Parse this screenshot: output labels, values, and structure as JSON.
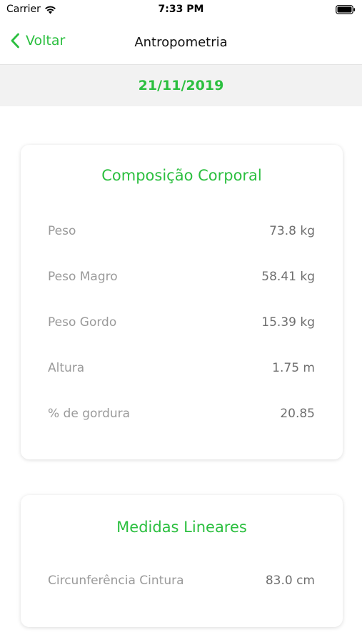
{
  "status_bar": {
    "carrier": "Carrier",
    "time": "7:33 PM"
  },
  "nav": {
    "back_label": "Voltar",
    "title": "Antropometria"
  },
  "date": "21/11/2019",
  "composicao": {
    "title": "Composição Corporal",
    "rows": [
      {
        "label": "Peso",
        "value": "73.8 kg"
      },
      {
        "label": "Peso Magro",
        "value": "58.41 kg"
      },
      {
        "label": "Peso Gordo",
        "value": "15.39 kg"
      },
      {
        "label": "Altura",
        "value": "1.75 m"
      },
      {
        "label": "% de gordura",
        "value": "20.85"
      }
    ]
  },
  "medidas": {
    "title": "Medidas Lineares",
    "rows": [
      {
        "label": "Circunferência Cintura",
        "value": "83.0 cm"
      }
    ]
  },
  "colors": {
    "accent": "#2bbf3f",
    "date_band": "#f2f2f2",
    "label_gray": "#9a9a9a",
    "value_gray": "#6f6f6f"
  },
  "icons": {
    "wifi": "wifi-icon",
    "battery": "battery-icon",
    "back": "chevron-left-icon"
  }
}
